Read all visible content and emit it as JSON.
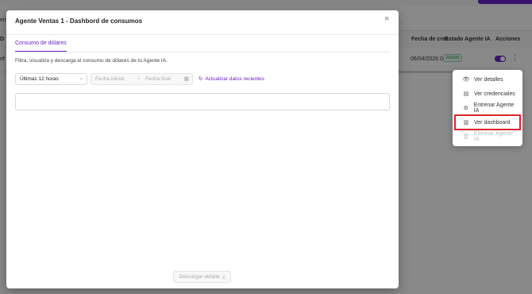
{
  "background": {
    "left_cut_text": "ein",
    "table": {
      "columns": [
        {
          "label": "D"
        },
        {
          "label": "Fecha de crea"
        },
        {
          "label": "Estado Agente IA"
        },
        {
          "label": "Acciones"
        }
      ],
      "row": {
        "left_cut": "nf",
        "date": "06/04/2026 0",
        "status": "Activo"
      }
    }
  },
  "menu": {
    "items": [
      {
        "label": "Ver detalles",
        "icon": "eye-icon"
      },
      {
        "label": "Ver credenciales",
        "icon": "document-icon"
      },
      {
        "label": "Entrenar Agente IA",
        "icon": "gear-icon"
      },
      {
        "label": "Ver dashboard",
        "icon": "bar-chart-icon"
      },
      {
        "label": "Eliminar Agente IA",
        "icon": "trash-icon"
      }
    ]
  },
  "modal": {
    "title": "Agente Ventas 1 - Dashbord de consumos",
    "close": "×",
    "tab": "Consumo de dólares",
    "description": "Filtra, visualiza y descarga el consumo de dólares de tu Agente IA.",
    "period_select": {
      "value": "Últimas 12 horas"
    },
    "date_range": {
      "start_placeholder": "Fecha inicial",
      "end_placeholder": "Fecha final"
    },
    "refresh_label": "Actualizar datos recientes",
    "download_label": "Descargar detalle"
  },
  "colors": {
    "accent": "#6b21c8",
    "highlight": "#d9252a",
    "active_status": "#1f9d55"
  }
}
